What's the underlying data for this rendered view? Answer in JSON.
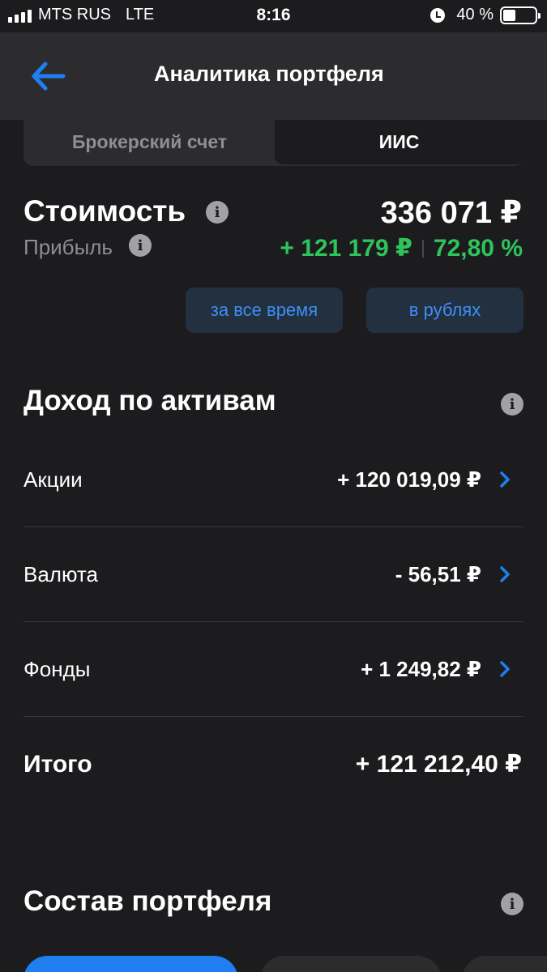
{
  "status_bar": {
    "carrier": "MTS RUS",
    "network": "LTE",
    "time": "8:16",
    "battery_percent": "40 %",
    "battery_level": 0.4
  },
  "header": {
    "title": "Аналитика портфеля",
    "back_icon": "arrow-left-icon"
  },
  "account_tabs": [
    {
      "label": "Брокерский счет",
      "active": false
    },
    {
      "label": "ИИС",
      "active": true
    }
  ],
  "summary": {
    "value_label": "Стоимость",
    "value_amount": "336 071 ₽",
    "profit_label": "Прибыль",
    "profit_amount": "+ 121 179 ₽",
    "profit_percent": "72,80 %"
  },
  "filters": {
    "period": "за все время",
    "currency": "в рублях"
  },
  "income_section": {
    "title": "Доход по активам",
    "rows": [
      {
        "name": "Акции",
        "amount": "+ 120 019,09 ₽"
      },
      {
        "name": "Валюта",
        "amount": "- 56,51 ₽"
      },
      {
        "name": "Фонды",
        "amount": "+ 1 249,82 ₽"
      }
    ],
    "total_label": "Итого",
    "total_amount": "+ 121 212,40 ₽"
  },
  "composition_section": {
    "title": "Состав портфеля"
  },
  "colors": {
    "background": "#1c1c1e",
    "header": "#2c2c2e",
    "accent": "#1f7ff0",
    "link": "#3d8ef5",
    "positive": "#2ec45a",
    "muted": "#8e8e93"
  },
  "icons": {
    "info": "info-icon",
    "chevron": "chevron-right-icon",
    "alarm": "alarm-icon",
    "battery": "battery-icon",
    "signal": "signal-icon"
  }
}
